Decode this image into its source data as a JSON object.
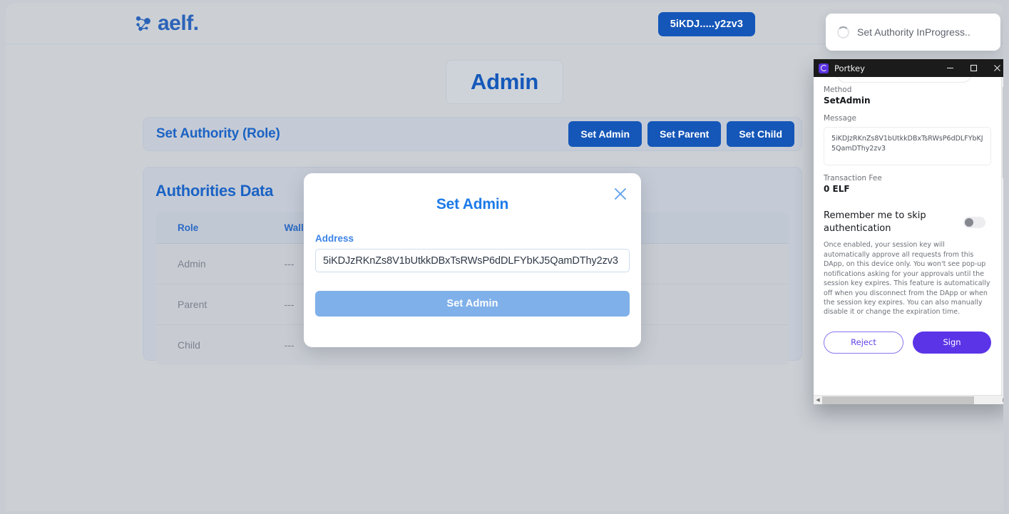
{
  "header": {
    "brand_name": "aelf.",
    "brand_icon": "aelf-logo-icon",
    "wallet_label": "5iKDJ.....y2zv3"
  },
  "page": {
    "title": "Admin"
  },
  "set_authority": {
    "title": "Set Authority (Role)",
    "buttons": [
      {
        "label": "Set Admin",
        "name": "set-admin-button"
      },
      {
        "label": "Set Parent",
        "name": "set-parent-button"
      },
      {
        "label": "Set Child",
        "name": "set-child-button"
      }
    ]
  },
  "authorities": {
    "title": "Authorities Data",
    "columns": [
      "Role",
      "Wallet Address",
      ""
    ],
    "rows": [
      {
        "role": "Admin",
        "wallet_address": "---",
        "extra": ""
      },
      {
        "role": "Parent",
        "wallet_address": "---",
        "extra": ""
      },
      {
        "role": "Child",
        "wallet_address": "---",
        "extra": ""
      }
    ]
  },
  "modal": {
    "title": "Set Admin",
    "close_icon": "close-icon",
    "field_label": "Address",
    "address_value": "5iKDJzRKnZs8V1bUtkkDBxTsRWsP6dDLFYbKJ5QamDThy2zv3",
    "address_placeholder": "Address",
    "submit_label": "Set Admin"
  },
  "toast": {
    "spinner_icon": "loading-spinner-icon",
    "message": "Set Authority InProgress.."
  },
  "portkey": {
    "window_title": "Portkey",
    "app_icon": "portkey-logo-icon",
    "controls": {
      "minimize_icon": "minimize-icon",
      "maximize_icon": "maximize-icon",
      "close_icon": "close-icon"
    },
    "method_label": "Method",
    "method_value": "SetAdmin",
    "message_label": "Message",
    "message_value": "5iKDJzRKnZs8V1bUtkkDBxTsRWsP6dDLFYbKJ5QamDThy2zv3",
    "fee_label": "Transaction Fee",
    "fee_value": "0 ELF",
    "remember_label": "Remember me to skip authentication",
    "remember_toggle_state": "off",
    "description": "Once enabled, your session key will automatically approve all requests from this DApp, on this device only. You won't see pop-up notifications asking for your approvals until the session key expires. This feature is automatically off when you disconnect from the DApp or when the session key expires. You can also manually disable it or change the expiration time.",
    "reject_label": "Reject",
    "sign_label": "Sign"
  },
  "colors": {
    "page_background": "#ccd0d5",
    "brand_blue": "#2b63b8",
    "primary_button": "#1557b8",
    "panel_background": "#c5cbd6",
    "modal_accent": "#1c7ae8",
    "modal_submit": "#7fb0ea",
    "portkey_purple": "#5b34e8",
    "portkey_titlebar": "#1b1b1b"
  }
}
